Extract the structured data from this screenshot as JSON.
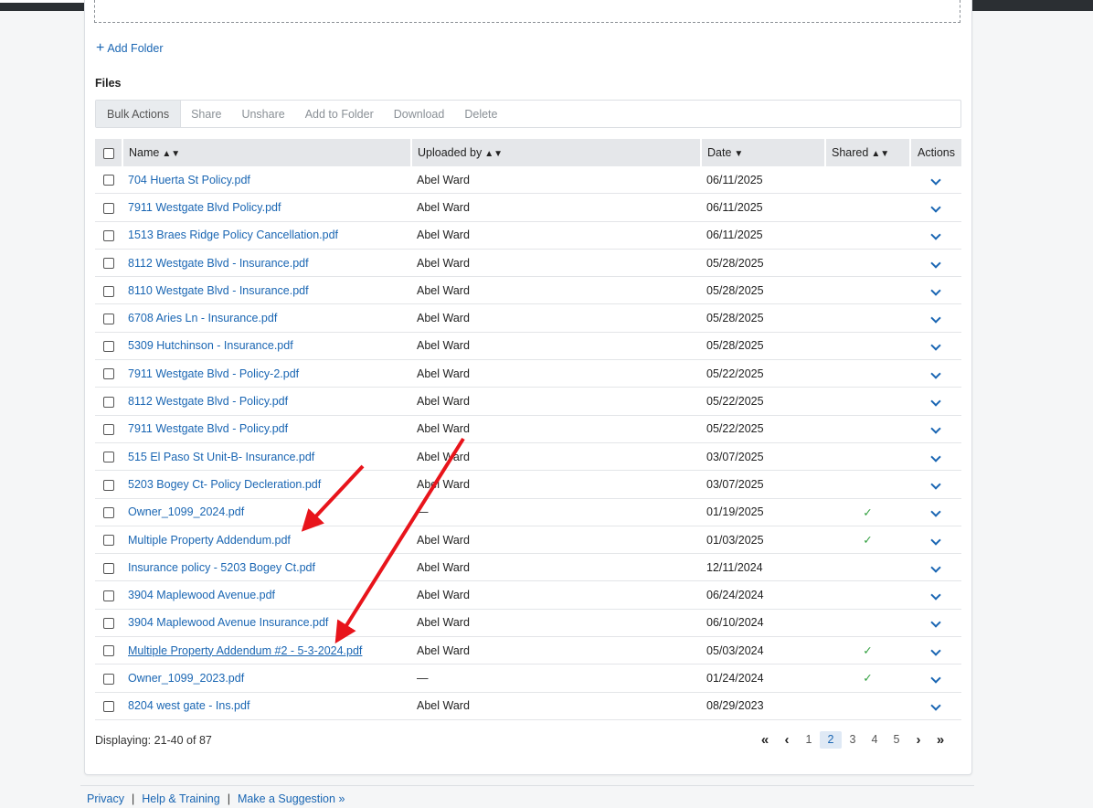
{
  "actions": {
    "add_folder": "Add Folder"
  },
  "files_heading": "Files",
  "bulk_actions": {
    "label": "Bulk Actions",
    "buttons": [
      "Share",
      "Unshare",
      "Add to Folder",
      "Download",
      "Delete"
    ]
  },
  "table": {
    "headers": {
      "name": "Name",
      "uploaded_by": "Uploaded by",
      "date": "Date",
      "shared": "Shared",
      "actions": "Actions"
    },
    "rows": [
      {
        "name": "704 Huerta St Policy.pdf",
        "uploaded_by": "Abel Ward",
        "date": "06/11/2025",
        "shared": ""
      },
      {
        "name": "7911 Westgate Blvd Policy.pdf",
        "uploaded_by": "Abel Ward",
        "date": "06/11/2025",
        "shared": ""
      },
      {
        "name": "1513 Braes Ridge Policy Cancellation.pdf",
        "uploaded_by": "Abel Ward",
        "date": "06/11/2025",
        "shared": ""
      },
      {
        "name": "8112 Westgate Blvd - Insurance.pdf",
        "uploaded_by": "Abel Ward",
        "date": "05/28/2025",
        "shared": ""
      },
      {
        "name": "8110 Westgate Blvd - Insurance.pdf",
        "uploaded_by": "Abel Ward",
        "date": "05/28/2025",
        "shared": ""
      },
      {
        "name": "6708 Aries Ln - Insurance.pdf",
        "uploaded_by": "Abel Ward",
        "date": "05/28/2025",
        "shared": ""
      },
      {
        "name": "5309 Hutchinson - Insurance.pdf",
        "uploaded_by": "Abel Ward",
        "date": "05/28/2025",
        "shared": ""
      },
      {
        "name": "7911 Westgate Blvd - Policy-2.pdf",
        "uploaded_by": "Abel Ward",
        "date": "05/22/2025",
        "shared": ""
      },
      {
        "name": "8112 Westgate Blvd - Policy.pdf",
        "uploaded_by": "Abel Ward",
        "date": "05/22/2025",
        "shared": ""
      },
      {
        "name": "7911 Westgate Blvd - Policy.pdf",
        "uploaded_by": "Abel Ward",
        "date": "05/22/2025",
        "shared": ""
      },
      {
        "name": "515 El Paso St Unit-B- Insurance.pdf",
        "uploaded_by": "Abel Ward",
        "date": "03/07/2025",
        "shared": ""
      },
      {
        "name": "5203 Bogey Ct- Policy Decleration.pdf",
        "uploaded_by": "Abel Ward",
        "date": "03/07/2025",
        "shared": ""
      },
      {
        "name": "Owner_1099_2024.pdf",
        "uploaded_by": "—",
        "date": "01/19/2025",
        "shared": "✓"
      },
      {
        "name": "Multiple Property Addendum.pdf",
        "uploaded_by": "Abel Ward",
        "date": "01/03/2025",
        "shared": "✓"
      },
      {
        "name": "Insurance policy - 5203 Bogey Ct.pdf",
        "uploaded_by": "Abel Ward",
        "date": "12/11/2024",
        "shared": ""
      },
      {
        "name": "3904 Maplewood Avenue.pdf",
        "uploaded_by": "Abel Ward",
        "date": "06/24/2024",
        "shared": ""
      },
      {
        "name": "3904 Maplewood Avenue Insurance.pdf",
        "uploaded_by": "Abel Ward",
        "date": "06/10/2024",
        "shared": ""
      },
      {
        "name": "Multiple Property Addendum #2 - 5-3-2024.pdf",
        "uploaded_by": "Abel Ward",
        "date": "05/03/2024",
        "shared": "✓"
      },
      {
        "name": "Owner_1099_2023.pdf",
        "uploaded_by": "—",
        "date": "01/24/2024",
        "shared": "✓"
      },
      {
        "name": "8204 west gate - Ins.pdf",
        "uploaded_by": "Abel Ward",
        "date": "08/29/2023",
        "shared": ""
      }
    ]
  },
  "pagination": {
    "displaying": "Displaying: 21-40 of 87",
    "pages": [
      "1",
      "2",
      "3",
      "4",
      "5"
    ],
    "current": "2"
  },
  "footer": {
    "links": [
      "Privacy",
      "Help & Training",
      "Make a Suggestion »"
    ]
  },
  "colors": {
    "link": "#1a66b3",
    "check": "#2e9e3c",
    "annotation_arrow": "#e8141b"
  }
}
